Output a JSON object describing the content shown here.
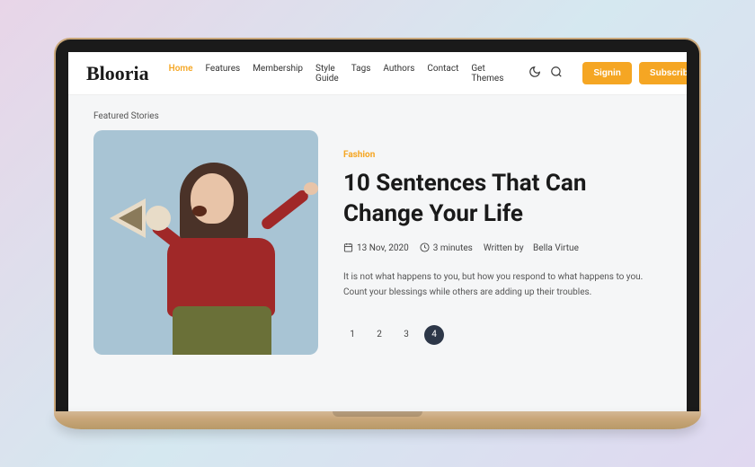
{
  "brand": "Blooria",
  "nav": {
    "items": [
      {
        "label": "Home",
        "active": true
      },
      {
        "label": "Features"
      },
      {
        "label": "Membership"
      },
      {
        "label": "Style Guide"
      },
      {
        "label": "Tags"
      },
      {
        "label": "Authors"
      },
      {
        "label": "Contact"
      },
      {
        "label": "Get Themes"
      }
    ],
    "signin": "Signin",
    "subscribe": "Subscribe"
  },
  "section_label": "Featured Stories",
  "story": {
    "category": "Fashion",
    "title": "10 Sentences That Can Change Your Life",
    "date": "13 Nov, 2020",
    "read_time": "3 minutes",
    "author_prefix": "Written by",
    "author": "Bella Virtue",
    "excerpt": "It is not what happens to you, but how you respond to what happens to you. Count your blessings while others are adding up their troubles."
  },
  "pagination": {
    "pages": [
      "1",
      "2",
      "3",
      "4"
    ],
    "active": "4"
  }
}
